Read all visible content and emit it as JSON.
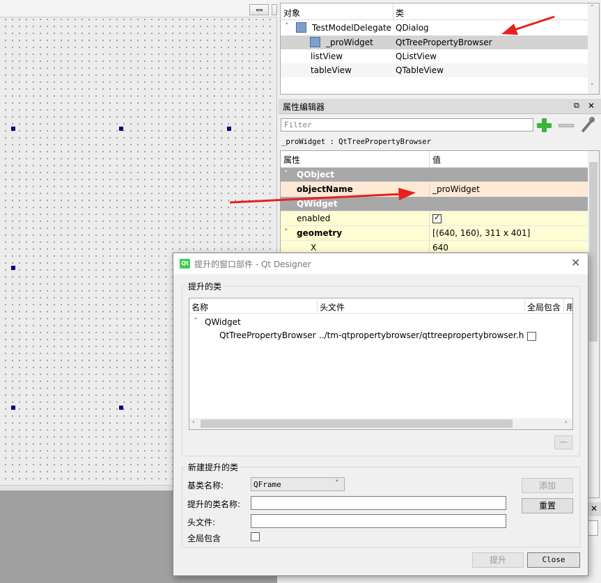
{
  "object_inspector": {
    "col_object": "对象",
    "col_class": "类",
    "rows": [
      {
        "name": "TestModelDelegate",
        "class": "QDialog"
      },
      {
        "name": "_proWidget",
        "class": "QtTreePropertyBrowser"
      },
      {
        "name": "listView",
        "class": "QListView"
      },
      {
        "name": "tableView",
        "class": "QTableView"
      }
    ]
  },
  "property_editor": {
    "title": "属性编辑器",
    "filter_placeholder": "Filter",
    "object_label": "_proWidget : QtTreePropertyBrowser",
    "col_property": "属性",
    "col_value": "值",
    "rows": [
      {
        "name": "QObject",
        "value": ""
      },
      {
        "name": "objectName",
        "value": "_proWidget"
      },
      {
        "name": "QWidget",
        "value": ""
      },
      {
        "name": "enabled",
        "value": ""
      },
      {
        "name": "geometry",
        "value": "[(640, 160), 311 x 401]"
      },
      {
        "name": "X",
        "value": "640"
      }
    ]
  },
  "dialog": {
    "title": "提升的窗口部件 - Qt Designer",
    "promoted_group": "提升的类",
    "columns": [
      "名称",
      "头文件",
      "全局包含",
      "用"
    ],
    "tree": {
      "parent": "QWidget",
      "child_name": "QtTreePropertyBrowser",
      "child_header": "../tm-qtpropertybrowser/qttreepropertybrowser.h"
    },
    "remove_button": "—",
    "new_group": "新建提升的类",
    "base_class_label": "基类名称:",
    "base_class_value": "QFrame",
    "promoted_name_label": "提升的类名称:",
    "header_file_label": "头文件:",
    "global_include_label": "全局包含",
    "add_button": "添加",
    "reset_button": "重置",
    "promote_button": "提升",
    "close_button": "Close"
  },
  "icons": [
    "minimize-icon",
    "expand-arrow-icon",
    "widget-icon",
    "plus-icon",
    "minus-icon",
    "wrench-icon",
    "float-icon",
    "close-icon",
    "qt-logo-icon",
    "checkbox-icon",
    "red-arrow-icon"
  ],
  "colors": {
    "arrow": "#e8201c",
    "group_row": "#a8a8a8",
    "highlight_row": "#fde9d4",
    "yellow_row": "#fefdd4"
  }
}
